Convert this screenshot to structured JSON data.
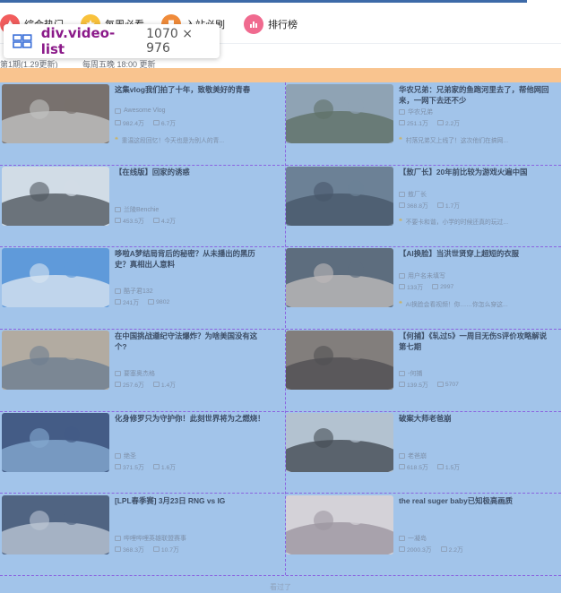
{
  "nav": {
    "items": [
      {
        "label": "综合热门",
        "icon": "fire-icon",
        "color": "#f25d5d"
      },
      {
        "label": "每周必看",
        "icon": "star-icon",
        "color": "#f9c23c"
      },
      {
        "label": "入站必刷",
        "icon": "bookmark-icon",
        "color": "#f08b3a"
      },
      {
        "label": "排行榜",
        "icon": "chart-icon",
        "color": "#f06a8f"
      }
    ]
  },
  "subbar": {
    "issue": "第1期(1.29更新)",
    "schedule": "每周五晚 18:00 更新"
  },
  "inspector": {
    "tag": "div.video-list",
    "dims": "1070 × 976"
  },
  "videos": [
    {
      "title": "这集vlog我们拍了十年，致敬美好的青春",
      "up": "Awesome Vlog",
      "views": "982.4万",
      "danmaku": "6.7万",
      "comment": "重温这段回忆！今天也是为别人的青..."
    },
    {
      "title": "华农兄弟：兄弟家的鱼跑河里去了，帮他网回来，一网下去还不少",
      "up": "华农兄弟",
      "views": "251.1万",
      "danmaku": "2.2万",
      "comment": "村落兄弟又上线了！这次他们在搞网..."
    },
    {
      "title": "【在线版】回家的诱惑",
      "up": "兰陵Benchie",
      "views": "453.5万",
      "danmaku": "4.2万",
      "comment": ""
    },
    {
      "title": "【敖厂长】20年前比较为游戏火遍中国",
      "up": "敖厂长",
      "views": "368.8万",
      "danmaku": "1.7万",
      "comment": "不要卡和谐，小学的时候还真的玩过..."
    },
    {
      "title": "哆啦A梦结局背后的秘密？从未播出的黑历史？真相出人意料",
      "up": "酷子君132",
      "views": "241万",
      "danmaku": "9802",
      "comment": ""
    },
    {
      "title": "【AI换脸】当洪世贤穿上超短的衣服",
      "up": "用户名未填写",
      "views": "133万",
      "danmaku": "2997",
      "comment": "AI换脸会看视频！你……你怎么穿这..."
    },
    {
      "title": "在中国挑战遵纪守法爆炸？为啥美国没有这个?",
      "up": "要塞奥杰格",
      "views": "257.6万",
      "danmaku": "1.4万",
      "comment": ""
    },
    {
      "title": "【何捕】《轧过5》一周目无伤S评价攻略解说 第七期",
      "up": "-何捕",
      "views": "139.5万",
      "danmaku": "5707",
      "comment": ""
    },
    {
      "title": "化身修罗只为守护你！此刻世界将为之燃烧！",
      "up": "绝圣",
      "views": "371.5万",
      "danmaku": "1.6万",
      "comment": ""
    },
    {
      "title": "破案大师老爸崩",
      "up": "老爸崩",
      "views": "618.5万",
      "danmaku": "1.5万",
      "comment": ""
    },
    {
      "title": "[LPL春季赛] 3月23日 RNG vs IG",
      "up": "哔哩哔哩英雄联盟赛事",
      "views": "368.3万",
      "danmaku": "10.7万",
      "comment": ""
    },
    {
      "title": "the real suger baby已知极高画质",
      "up": "一凝岛",
      "views": "2000.3万",
      "danmaku": "2.2万",
      "comment": ""
    }
  ],
  "footer": {
    "more": "看过了"
  }
}
